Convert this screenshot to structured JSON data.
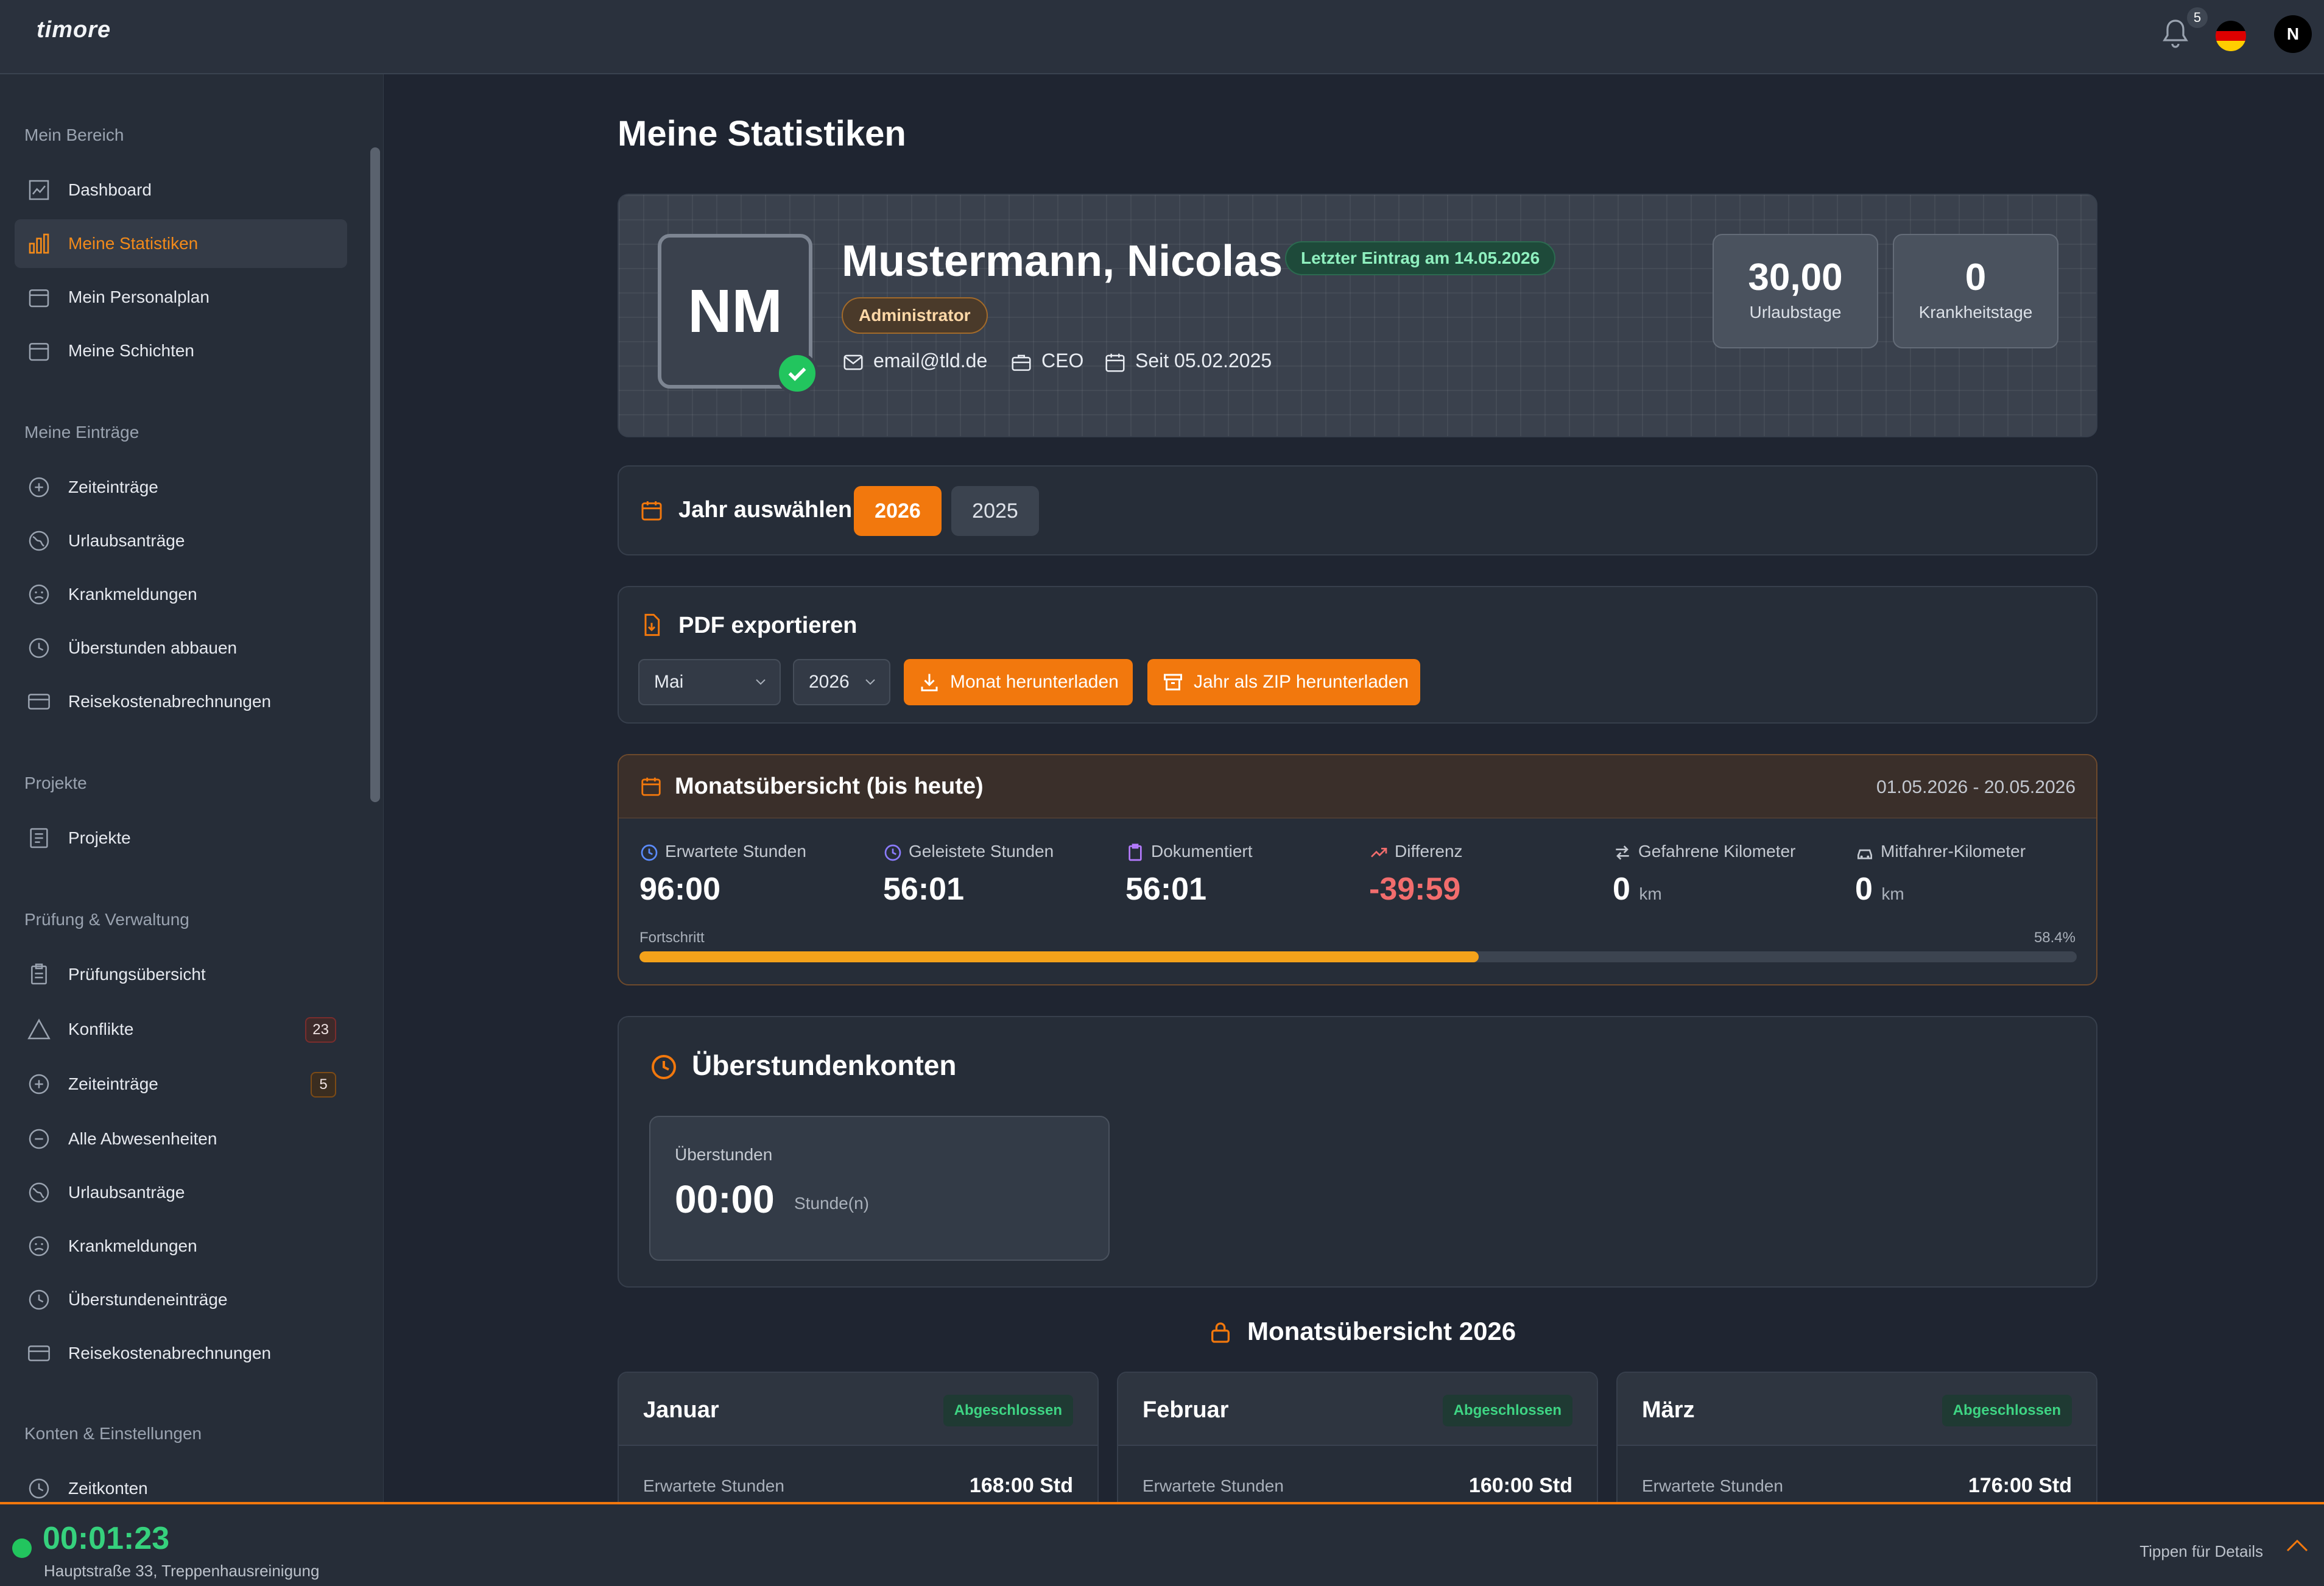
{
  "app": {
    "logo": "timore"
  },
  "topbar": {
    "notifications": "5",
    "user_initial": "N"
  },
  "sidebar": {
    "groups": [
      "Mein Bereich",
      "Meine Einträge",
      "Projekte",
      "Prüfung & Verwaltung",
      "Konten & Einstellungen"
    ],
    "items": [
      {
        "label": "Dashboard"
      },
      {
        "label": "Meine Statistiken"
      },
      {
        "label": "Mein Personalplan"
      },
      {
        "label": "Meine Schichten"
      },
      {
        "label": "Zeiteinträge"
      },
      {
        "label": "Urlaubsanträge"
      },
      {
        "label": "Krankmeldungen"
      },
      {
        "label": "Überstunden abbauen"
      },
      {
        "label": "Reisekostenabrechnungen"
      },
      {
        "label": "Projekte"
      },
      {
        "label": "Prüfungsübersicht"
      },
      {
        "label": "Konflikte",
        "badge": "23"
      },
      {
        "label": "Zeiteinträge",
        "badge": "5"
      },
      {
        "label": "Alle Abwesenheiten"
      },
      {
        "label": "Urlaubsanträge"
      },
      {
        "label": "Krankmeldungen"
      },
      {
        "label": "Überstundeneinträge"
      },
      {
        "label": "Reisekostenabrechnungen"
      },
      {
        "label": "Zeitkonten"
      }
    ]
  },
  "page": {
    "title": "Meine Statistiken"
  },
  "profile": {
    "initials": "NM",
    "name": "Mustermann, Nicolas",
    "last_entry": "Letzter Eintrag am 14.05.2026",
    "role": "Administrator",
    "email": "email@tld.de",
    "position": "CEO",
    "since": "Seit 05.02.2025",
    "vacation_days": "30,00",
    "vacation_label": "Urlaubstage",
    "sick_days": "0",
    "sick_label": "Krankheitstage"
  },
  "year_select": {
    "title": "Jahr auswählen",
    "years": [
      "2026",
      "2025"
    ],
    "selected": "2026"
  },
  "pdf_export": {
    "title": "PDF exportieren",
    "month_value": "Mai",
    "year_value": "2026",
    "month_button": "Monat herunterladen",
    "zip_button": "Jahr als ZIP herunterladen"
  },
  "month_overview": {
    "title": "Monatsübersicht (bis heute)",
    "range": "01.05.2026 - 20.05.2026",
    "kpis": [
      {
        "label": "Erwartete Stunden",
        "value": "96:00",
        "unit": ""
      },
      {
        "label": "Geleistete Stunden",
        "value": "56:01",
        "unit": ""
      },
      {
        "label": "Dokumentiert",
        "value": "56:01",
        "unit": ""
      },
      {
        "label": "Differenz",
        "value": "-39:59",
        "unit": ""
      },
      {
        "label": "Gefahrene Kilometer",
        "value": "0",
        "unit": "km"
      },
      {
        "label": "Mitfahrer-Kilometer",
        "value": "0",
        "unit": "km"
      }
    ],
    "progress_label": "Fortschritt",
    "progress_text": "58.4%",
    "progress": 58.4
  },
  "overtime": {
    "title": "Überstundenkonten",
    "label": "Überstunden",
    "value": "00:00",
    "unit": "Stunde(n)"
  },
  "year_overview": {
    "title": "Monatsübersicht 2026",
    "months": [
      {
        "name": "Januar",
        "status": "Abgeschlossen",
        "row_label": "Erwartete Stunden",
        "row_value": "168:00 Std"
      },
      {
        "name": "Februar",
        "status": "Abgeschlossen",
        "row_label": "Erwartete Stunden",
        "row_value": "160:00 Std"
      },
      {
        "name": "März",
        "status": "Abgeschlossen",
        "row_label": "Erwartete Stunden",
        "row_value": "176:00 Std"
      }
    ]
  },
  "timer": {
    "time": "00:01:23",
    "location": "Hauptstraße 33, Treppenhausreinigung",
    "hint": "Tippen für Details"
  },
  "colors": {
    "accent": "#f2780d",
    "success": "#22c55e",
    "danger": "#f26d6d",
    "progress": "#f4a21a"
  }
}
